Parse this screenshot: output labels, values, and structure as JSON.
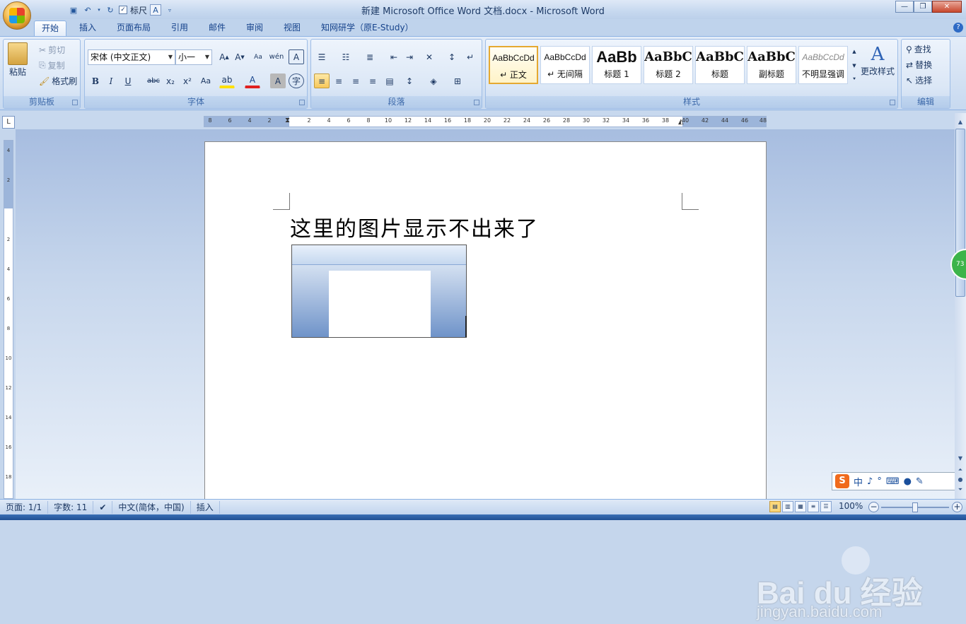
{
  "window": {
    "title": "新建 Microsoft Office Word 文档.docx - Microsoft Word"
  },
  "qat": {
    "ruler_label": "标尺",
    "ruler_checked": "✓"
  },
  "tabs": [
    "开始",
    "插入",
    "页面布局",
    "引用",
    "邮件",
    "审阅",
    "视图",
    "知网研学（原E-Study）"
  ],
  "clipboard": {
    "paste": "粘贴",
    "cut": "剪切",
    "copy": "复制",
    "format_painter": "格式刷",
    "group_label": "剪贴板"
  },
  "font": {
    "name": "宋体 (中文正文)",
    "size": "小一",
    "group_label": "字体"
  },
  "paragraph": {
    "group_label": "段落"
  },
  "styles": {
    "items": [
      {
        "preview": "AaBbCcDd",
        "name": "↵ 正文"
      },
      {
        "preview": "AaBbCcDd",
        "name": "↵ 无间隔"
      },
      {
        "preview": "AaBb",
        "name": "标题 1"
      },
      {
        "preview": "AaBbC",
        "name": "标题 2"
      },
      {
        "preview": "AaBbC",
        "name": "标题"
      },
      {
        "preview": "AaBbC",
        "name": "副标题"
      },
      {
        "preview": "AaBbCcDd",
        "name": "不明显强调"
      }
    ],
    "change_styles": "更改样式",
    "group_label": "样式"
  },
  "editing": {
    "find": "查找",
    "replace": "替换",
    "select": "选择",
    "group_label": "编辑"
  },
  "ruler": {
    "ticks": [
      "8",
      "6",
      "4",
      "2",
      "2",
      "4",
      "6",
      "8",
      "10",
      "12",
      "14",
      "16",
      "18",
      "20",
      "22",
      "24",
      "26",
      "28",
      "30",
      "32",
      "34",
      "36",
      "38",
      "40",
      "42",
      "44",
      "46",
      "48"
    ]
  },
  "vruler": {
    "ticks": [
      "4",
      "2",
      "2",
      "4",
      "6",
      "8",
      "10",
      "12",
      "14",
      "16",
      "18"
    ]
  },
  "document": {
    "text": "这里的图片显示不出来了"
  },
  "green_badge": "73",
  "watermark": {
    "main": "Bai du 经验",
    "url": "jingyan.baidu.com"
  },
  "ime": {
    "lang": "中",
    "logo": "S"
  },
  "status": {
    "page": "页面: 1/1",
    "words": "字数: 11",
    "language": "中文(简体，中国)",
    "mode": "插入",
    "zoom": "100%"
  }
}
